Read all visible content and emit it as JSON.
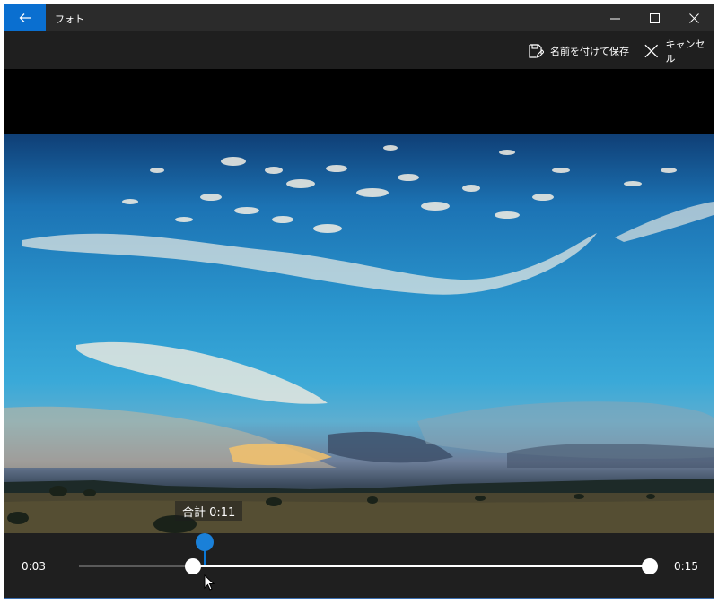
{
  "window": {
    "title": "フォト",
    "icons": {
      "back": "arrow-left-icon",
      "minimize": "minimize-icon",
      "maximize": "maximize-icon",
      "close": "close-icon"
    }
  },
  "commandbar": {
    "save_as_label": "名前を付けて保存",
    "save_as_icon": "save-as-icon",
    "cancel_label": "キャンセル",
    "cancel_icon": "close-icon"
  },
  "video": {
    "total_label": "合計 0:11",
    "content": "landscape-sky-video-frame"
  },
  "timeline": {
    "start_time": "0:03",
    "end_time": "0:15",
    "trim_start_fraction": 0.2,
    "trim_end_fraction": 1.0,
    "playhead_fraction": 0.22
  },
  "colors": {
    "accent": "#0a6fd0",
    "background": "#1f1f1f",
    "titlebar": "#2b2b2b"
  }
}
